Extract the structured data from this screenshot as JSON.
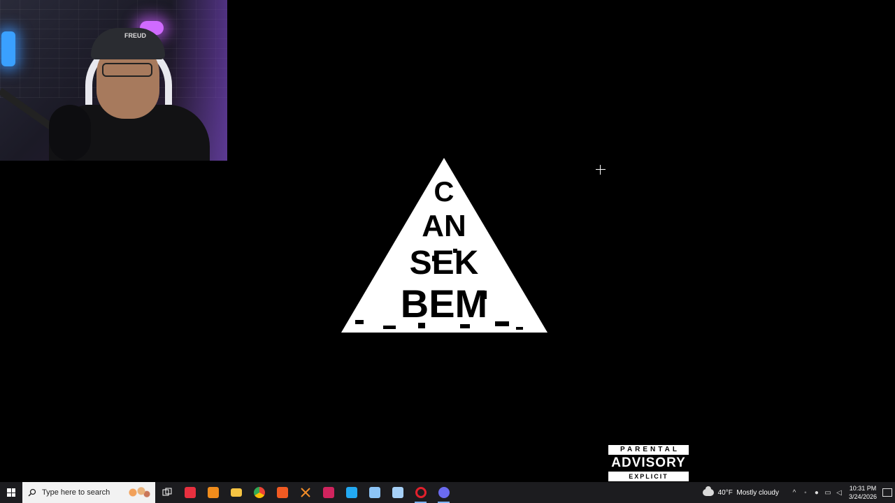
{
  "webcam": {
    "cap_text": "FREUD"
  },
  "logo": {
    "lines": [
      "C",
      "AN",
      "SEK",
      "BEM"
    ],
    "alt": "logo"
  },
  "advisory": {
    "top": "PARENTAL",
    "middle": "ADVISORY",
    "bottom": "EXPLICIT CONTENT"
  },
  "taskbar": {
    "search_placeholder": "Type here to search",
    "apps": [
      {
        "name": "task-view",
        "color": "#ffffff"
      },
      {
        "name": "app-red-a",
        "color": "#e8303f"
      },
      {
        "name": "app-orange",
        "color": "#f08c1c"
      },
      {
        "name": "file-explorer",
        "color": "#f6c443"
      },
      {
        "name": "chrome",
        "color": "#4b8df8"
      },
      {
        "name": "brave",
        "color": "#f15a22"
      },
      {
        "name": "app-x",
        "color": "#f28c28"
      },
      {
        "name": "app-magenta",
        "color": "#d0245e"
      },
      {
        "name": "vscode",
        "color": "#23a9f2"
      },
      {
        "name": "app-note",
        "color": "#8cc4f6"
      },
      {
        "name": "app-doc",
        "color": "#a6d0f7"
      },
      {
        "name": "opera",
        "color": "#e2202c"
      },
      {
        "name": "app-active",
        "color": "#6b6bf0"
      }
    ],
    "weather": {
      "temp": "40°F",
      "condition": "Mostly cloudy"
    },
    "clock": {
      "time": "10:31 PM",
      "date": "3/24/2026"
    }
  }
}
